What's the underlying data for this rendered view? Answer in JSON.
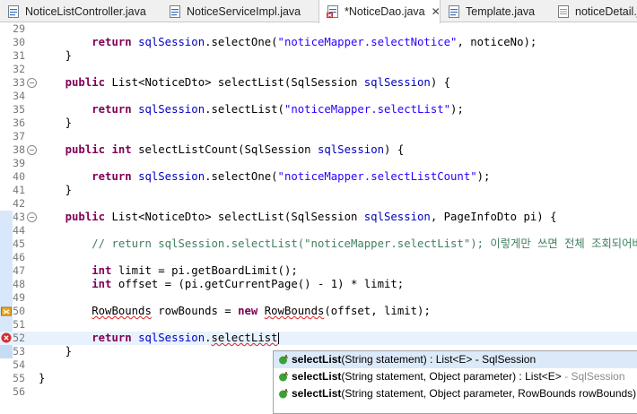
{
  "tabs": [
    {
      "label": "NoticeListController.java",
      "active": false
    },
    {
      "label": "NoticeServiceImpl.java",
      "active": false
    },
    {
      "label": "*NoticeDao.java",
      "active": true,
      "close": "✕"
    },
    {
      "label": "Template.java",
      "active": false
    },
    {
      "label": "noticeDetail.js",
      "active": false
    }
  ],
  "editor": {
    "lines": [
      {
        "n": "29",
        "tokens": []
      },
      {
        "n": "30",
        "tokens": [
          [
            "t",
            "        "
          ],
          [
            "kw",
            "return"
          ],
          [
            "t",
            " "
          ],
          [
            "fld",
            "sqlSession"
          ],
          [
            "t",
            ".selectOne("
          ],
          [
            "str",
            "\"noticeMapper.selectNotice\""
          ],
          [
            "t",
            ", noticeNo);"
          ]
        ]
      },
      {
        "n": "31",
        "tokens": [
          [
            "t",
            "    }"
          ]
        ]
      },
      {
        "n": "32",
        "tokens": []
      },
      {
        "n": "33",
        "fold": true,
        "tokens": [
          [
            "t",
            "    "
          ],
          [
            "kw",
            "public"
          ],
          [
            "t",
            " List<NoticeDto> selectList(SqlSession "
          ],
          [
            "fld",
            "sqlSession"
          ],
          [
            "t",
            ") {"
          ]
        ]
      },
      {
        "n": "34",
        "tokens": []
      },
      {
        "n": "35",
        "tokens": [
          [
            "t",
            "        "
          ],
          [
            "kw",
            "return"
          ],
          [
            "t",
            " "
          ],
          [
            "fld",
            "sqlSession"
          ],
          [
            "t",
            ".selectList("
          ],
          [
            "str",
            "\"noticeMapper.selectList\""
          ],
          [
            "t",
            ");"
          ]
        ]
      },
      {
        "n": "36",
        "tokens": [
          [
            "t",
            "    }"
          ]
        ]
      },
      {
        "n": "37",
        "tokens": []
      },
      {
        "n": "38",
        "fold": true,
        "tokens": [
          [
            "t",
            "    "
          ],
          [
            "kw",
            "public"
          ],
          [
            "t",
            " "
          ],
          [
            "kw",
            "int"
          ],
          [
            "t",
            " selectListCount(SqlSession "
          ],
          [
            "fld",
            "sqlSession"
          ],
          [
            "t",
            ") {"
          ]
        ]
      },
      {
        "n": "39",
        "tokens": []
      },
      {
        "n": "40",
        "tokens": [
          [
            "t",
            "        "
          ],
          [
            "kw",
            "return"
          ],
          [
            "t",
            " "
          ],
          [
            "fld",
            "sqlSession"
          ],
          [
            "t",
            ".selectOne("
          ],
          [
            "str",
            "\"noticeMapper.selectListCount\""
          ],
          [
            "t",
            ");"
          ]
        ]
      },
      {
        "n": "41",
        "tokens": [
          [
            "t",
            "    }"
          ]
        ]
      },
      {
        "n": "42",
        "tokens": []
      },
      {
        "n": "43",
        "fold": true,
        "tokens": [
          [
            "t",
            "    "
          ],
          [
            "kw",
            "public"
          ],
          [
            "t",
            " List<NoticeDto> selectList(SqlSession "
          ],
          [
            "fld",
            "sqlSession"
          ],
          [
            "t",
            ", PageInfoDto pi) {"
          ]
        ]
      },
      {
        "n": "44",
        "tokens": []
      },
      {
        "n": "45",
        "tokens": [
          [
            "t",
            "        "
          ],
          [
            "cmt",
            "// return sqlSession.selectList(\"noticeMapper.selectList\"); 이렇게만 쓰면 전체 조회되어버"
          ]
        ]
      },
      {
        "n": "46",
        "tokens": []
      },
      {
        "n": "47",
        "tokens": [
          [
            "t",
            "        "
          ],
          [
            "kw",
            "int"
          ],
          [
            "t",
            " limit = pi.getBoardLimit();"
          ]
        ]
      },
      {
        "n": "48",
        "tokens": [
          [
            "t",
            "        "
          ],
          [
            "kw",
            "int"
          ],
          [
            "t",
            " offset = (pi.getCurrentPage() - 1) * limit;"
          ]
        ]
      },
      {
        "n": "49",
        "tokens": []
      },
      {
        "n": "50",
        "marker": "warning",
        "tokens": [
          [
            "t",
            "        "
          ],
          [
            "err",
            "RowBounds"
          ],
          [
            "t",
            " rowBounds = "
          ],
          [
            "kw",
            "new"
          ],
          [
            "t",
            " "
          ],
          [
            "err",
            "RowBounds"
          ],
          [
            "t",
            "(offset, limit);"
          ]
        ]
      },
      {
        "n": "51",
        "tokens": []
      },
      {
        "n": "52",
        "marker": "error",
        "current": true,
        "tokens": [
          [
            "t",
            "        "
          ],
          [
            "kw",
            "return"
          ],
          [
            "t",
            " "
          ],
          [
            "fld",
            "sqlSession"
          ],
          [
            "t",
            "."
          ],
          [
            "err",
            "selectList"
          ],
          [
            "caret",
            ""
          ]
        ]
      },
      {
        "n": "53",
        "tokens": [
          [
            "t",
            "    }"
          ]
        ]
      },
      {
        "n": "54",
        "tokens": []
      },
      {
        "n": "55",
        "tokens": [
          [
            "t",
            "}"
          ]
        ]
      },
      {
        "n": "56",
        "tokens": []
      }
    ]
  },
  "autocomplete": {
    "items": [
      {
        "name": "selectList",
        "params": "(String statement) : List<E>",
        "sep": " - ",
        "owner": "SqlSession",
        "owner_grey": false,
        "selected": true
      },
      {
        "name": "selectList",
        "params": "(String statement, Object parameter) : List<E>",
        "sep": " - ",
        "owner": "SqlSession",
        "owner_grey": true,
        "selected": false
      },
      {
        "name": "selectList",
        "params": "(String statement, Object parameter, RowBounds rowBounds)",
        "sep": "",
        "owner": "",
        "owner_grey": false,
        "selected": false
      }
    ]
  },
  "colors": {
    "keyword": "#7f0055",
    "string": "#2a00ff",
    "field": "#0000c0",
    "comment": "#3f7f5f",
    "current_line": "#e8f2fe"
  }
}
